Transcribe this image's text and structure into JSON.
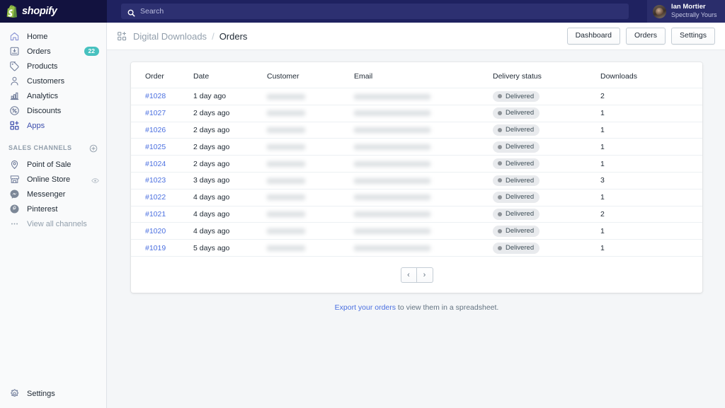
{
  "topbar": {
    "brand": "shopify",
    "brand_icon": "shopify-bag-icon",
    "search": {
      "icon": "search-icon",
      "placeholder": "Search",
      "value": ""
    },
    "user": {
      "name": "Ian Mortier",
      "store": "Spectrally Yours",
      "avatar": "user-avatar"
    }
  },
  "sidebar": {
    "items": [
      {
        "label": "Home",
        "icon": "home-icon",
        "badge": null,
        "active": false
      },
      {
        "label": "Orders",
        "icon": "orders-icon",
        "badge": "22",
        "active": false
      },
      {
        "label": "Products",
        "icon": "products-icon",
        "badge": null,
        "active": false
      },
      {
        "label": "Customers",
        "icon": "customers-icon",
        "badge": null,
        "active": false
      },
      {
        "label": "Analytics",
        "icon": "analytics-icon",
        "badge": null,
        "active": false
      },
      {
        "label": "Discounts",
        "icon": "discounts-icon",
        "badge": null,
        "active": false
      },
      {
        "label": "Apps",
        "icon": "apps-icon",
        "badge": null,
        "active": true
      }
    ],
    "section": {
      "title": "Sales channels",
      "add_icon": "plus-circle-icon"
    },
    "channels": [
      {
        "label": "Point of Sale",
        "icon": "location-pin-icon",
        "trailing_icon": null
      },
      {
        "label": "Online Store",
        "icon": "storefront-icon",
        "trailing_icon": "eye-icon"
      },
      {
        "label": "Messenger",
        "icon": "messenger-icon",
        "trailing_icon": null
      },
      {
        "label": "Pinterest",
        "icon": "pinterest-icon",
        "trailing_icon": null
      },
      {
        "label": "View all channels",
        "icon": "ellipsis-icon",
        "trailing_icon": null
      }
    ],
    "settings": {
      "label": "Settings",
      "icon": "gear-icon"
    }
  },
  "page_header": {
    "app_icon": "app-grid-plus-icon",
    "breadcrumb_parent": "Digital Downloads",
    "breadcrumb_separator": "/",
    "breadcrumb_current": "Orders",
    "actions": [
      {
        "label": "Dashboard"
      },
      {
        "label": "Orders"
      },
      {
        "label": "Settings"
      }
    ]
  },
  "table": {
    "columns": [
      "Order",
      "Date",
      "Customer",
      "Email",
      "Delivery status",
      "Downloads"
    ],
    "rows": [
      {
        "order": "#1028",
        "date": "1 day ago",
        "customer": "",
        "email": "",
        "status": "Delivered",
        "downloads": "2"
      },
      {
        "order": "#1027",
        "date": "2 days ago",
        "customer": "",
        "email": "",
        "status": "Delivered",
        "downloads": "1"
      },
      {
        "order": "#1026",
        "date": "2 days ago",
        "customer": "",
        "email": "",
        "status": "Delivered",
        "downloads": "1"
      },
      {
        "order": "#1025",
        "date": "2 days ago",
        "customer": "",
        "email": "",
        "status": "Delivered",
        "downloads": "1"
      },
      {
        "order": "#1024",
        "date": "2 days ago",
        "customer": "",
        "email": "",
        "status": "Delivered",
        "downloads": "1"
      },
      {
        "order": "#1023",
        "date": "3 days ago",
        "customer": "",
        "email": "",
        "status": "Delivered",
        "downloads": "3"
      },
      {
        "order": "#1022",
        "date": "4 days ago",
        "customer": "",
        "email": "",
        "status": "Delivered",
        "downloads": "1"
      },
      {
        "order": "#1021",
        "date": "4 days ago",
        "customer": "",
        "email": "",
        "status": "Delivered",
        "downloads": "2"
      },
      {
        "order": "#1020",
        "date": "4 days ago",
        "customer": "",
        "email": "",
        "status": "Delivered",
        "downloads": "1"
      },
      {
        "order": "#1019",
        "date": "5 days ago",
        "customer": "",
        "email": "",
        "status": "Delivered",
        "downloads": "1"
      }
    ]
  },
  "pagination": {
    "prev_label": "‹",
    "next_label": "›"
  },
  "footnote": {
    "link_text": "Export your orders",
    "rest_text": " to view them in a spreadsheet."
  },
  "colors": {
    "topbar": "#1f2260",
    "logo_zone": "#12123f",
    "accent_link": "#4a6fe0",
    "badge_teal": "#47c1bf",
    "page_bg": "#f4f6f8",
    "sidebar_bg": "#f9fafb",
    "status_pill_bg": "#e8eaed"
  }
}
